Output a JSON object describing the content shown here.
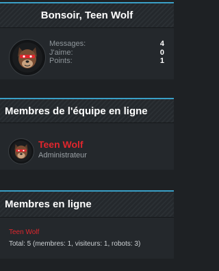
{
  "welcome": {
    "title": "Bonsoir, Teen Wolf",
    "stats": [
      {
        "label": "Messages:",
        "value": "4"
      },
      {
        "label": "J'aime:",
        "value": "0"
      },
      {
        "label": "Points:",
        "value": "1"
      }
    ]
  },
  "staff": {
    "title": "Membres de l'équipe en ligne",
    "member_name": "Teen Wolf",
    "member_role": "Administrateur"
  },
  "online": {
    "title": "Membres en ligne",
    "user": "Teen Wolf",
    "total": "Total: 5 (membres: 1, visiteurs: 1, robots: 3)"
  },
  "colors": {
    "accent": "#3aa0c7",
    "username": "#e0262d"
  }
}
